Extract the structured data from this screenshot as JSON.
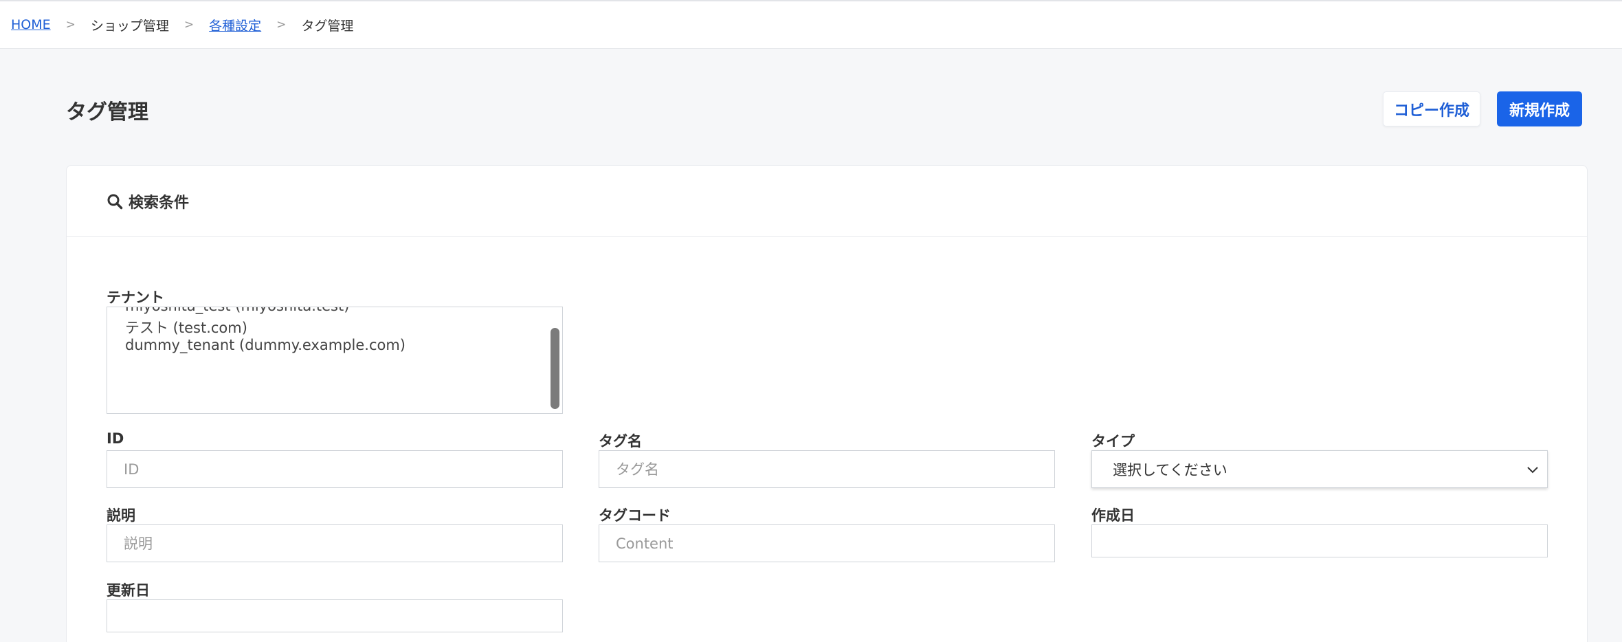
{
  "breadcrumb": {
    "home": "HOME",
    "shop": "ショップ管理",
    "settings": "各種設定",
    "current": "タグ管理",
    "separator": ">"
  },
  "page": {
    "title": "タグ管理",
    "copy_button": "コピー作成",
    "new_button": "新規作成"
  },
  "search": {
    "title": "検索条件",
    "tenant": {
      "label": "テナント",
      "options": [
        "miyoshita_test (miyoshita.test)",
        "テスト (test.com)",
        "dummy_tenant (dummy.example.com)"
      ]
    },
    "id": {
      "label": "ID",
      "placeholder": "ID"
    },
    "tag_name": {
      "label": "タグ名",
      "placeholder": "タグ名"
    },
    "type": {
      "label": "タイプ",
      "value": "選択してください"
    },
    "description": {
      "label": "説明",
      "placeholder": "説明"
    },
    "tag_code": {
      "label": "タグコード",
      "placeholder": "Content"
    },
    "created": {
      "label": "作成日",
      "value": ""
    },
    "updated": {
      "label": "更新日",
      "value": ""
    }
  },
  "colors": {
    "accent": "#1a64e8",
    "link": "#1f5fd6",
    "background": "#f6f7f9"
  }
}
